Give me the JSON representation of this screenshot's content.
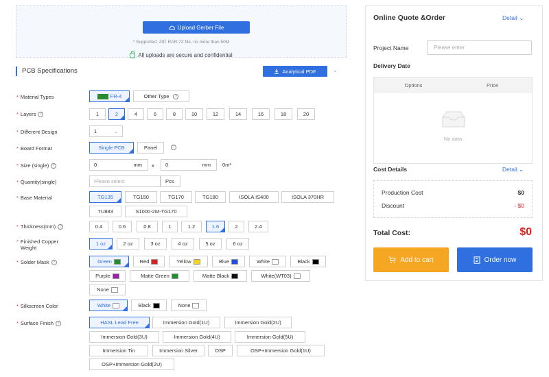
{
  "upload": {
    "button_label": "Upload Gerber File",
    "supported_note": "* Supported: ZIP, RAR,7Z file, no more than 50M",
    "secure_note": "All uploads are secure and confidential"
  },
  "spec": {
    "title": "PCB Specifications",
    "pdf_button": "Analytical PDF"
  },
  "rows": {
    "material_types": {
      "label": "Material Types",
      "options": [
        "FR-4",
        "Other Type"
      ],
      "selected": "FR-4"
    },
    "layers": {
      "label": "Layers",
      "options": [
        "1",
        "2",
        "4",
        "6",
        "8",
        "10",
        "12",
        "14",
        "16",
        "18",
        "20"
      ],
      "selected": "2"
    },
    "different_design": {
      "label": "Different Design",
      "value": "1"
    },
    "board_format": {
      "label": "Board Format",
      "options": [
        "Single PCB",
        "Panel"
      ],
      "selected": "Single PCB"
    },
    "size": {
      "label": "Size (single)",
      "value1": "0",
      "value2": "0",
      "unit": "mm",
      "sep": "x",
      "area": "0m²"
    },
    "quantity": {
      "label": "Quantity(single)",
      "placeholder": "Please select",
      "unit": "Pcs"
    },
    "base_material": {
      "label": "Base Material",
      "options": [
        "TG135",
        "TG150",
        "TG170",
        "TG180",
        "ISOLA IS400",
        "ISOLA 370HR",
        "TU883",
        "S1000-2M-TG170"
      ],
      "selected": "TG135"
    },
    "thickness": {
      "label": "Thickness(mm)",
      "options": [
        "0.4",
        "0.6",
        "0.8",
        "1",
        "1.2",
        "1.6",
        "2",
        "2.4"
      ],
      "selected": "1.6"
    },
    "copper_weight": {
      "label_line1": "Finished Copper",
      "label_line2": "Weight",
      "options": [
        "1 oz",
        "2 oz",
        "3 oz",
        "4 oz",
        "5 oz",
        "6 oz"
      ],
      "selected": "1 oz"
    },
    "solder_mask": {
      "label": "Solder Mask",
      "options": [
        {
          "name": "Green",
          "color": "#1e8f2e"
        },
        {
          "name": "Red",
          "color": "#e02020"
        },
        {
          "name": "Yellow",
          "color": "#f7d417"
        },
        {
          "name": "Blue",
          "color": "#1f4fe0"
        },
        {
          "name": "White",
          "color": "#ffffff"
        },
        {
          "name": "Black",
          "color": "#000000"
        },
        {
          "name": "Purple",
          "color": "#9b1fa8"
        },
        {
          "name": "Matte Green",
          "color": "#1e8f2e"
        },
        {
          "name": "Matte Black",
          "color": "#111111"
        },
        {
          "name": "White(WT03)",
          "color": "#ffffff"
        },
        {
          "name": "None",
          "color": "#ffffff"
        }
      ],
      "selected": "Green"
    },
    "silkscreen": {
      "label": "Silkscreen Color",
      "options": [
        {
          "name": "White",
          "color": "#ffffff"
        },
        {
          "name": "Black",
          "color": "#000000"
        },
        {
          "name": "None",
          "color": "#ffffff"
        }
      ],
      "selected": "White"
    },
    "surface_finish": {
      "label": "Surface Finish",
      "options": [
        "HASL Lead Free",
        "Immersion Gold(1U)",
        "Immersion Gold(2U)",
        "Immersion Gold(3U)",
        "Immersion Gold(4U)",
        "Immersion Gold(5U)",
        "Immersion Tin",
        "Immersion Silver",
        "OSP",
        "OSP+Immersion Gold(1U)",
        "OSP+Immersion Gold(2U)"
      ],
      "selected": "HASL Lead Free"
    }
  },
  "panel": {
    "title": "Online Quote &Order",
    "detail_link": "Detail",
    "project_name_label": "Project Name",
    "project_name_placeholder": "Please enter",
    "delivery_date_label": "Delivery Date",
    "table_headers": [
      "Options",
      "Price"
    ],
    "empty_text": "No data",
    "cost_details_label": "Cost Details",
    "cost_detail_link": "Detail",
    "production_cost_label": "Production Cost",
    "production_cost_value": "$0",
    "discount_label": "Discount",
    "discount_value": "- $0",
    "total_label": "Total Cost:",
    "total_value": "$0",
    "cart_button": "Add to cart",
    "order_button": "Order now"
  },
  "colors": {
    "accent": "#2f6fe0",
    "cart": "#f5a623",
    "total": "#e02020",
    "required": "#e33333"
  }
}
